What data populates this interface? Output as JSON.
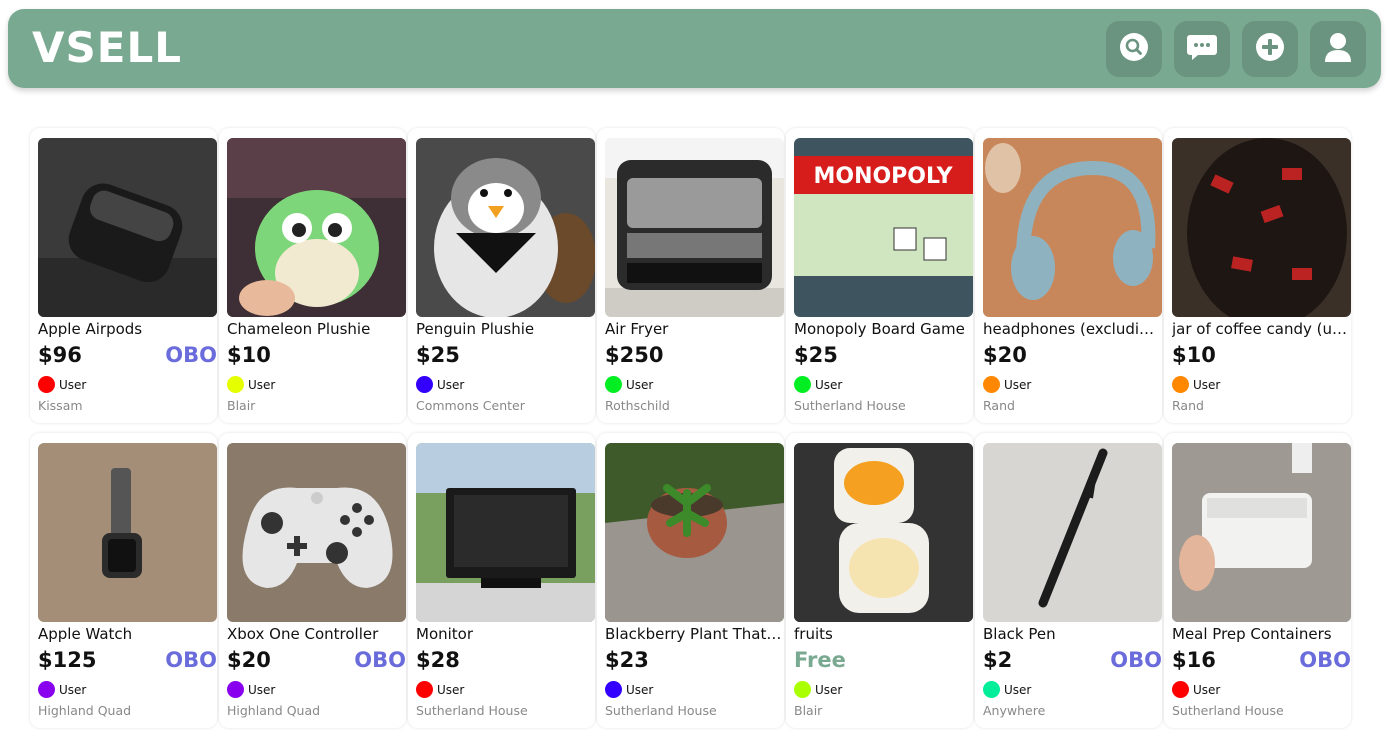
{
  "app": {
    "title": "VSELL"
  },
  "header": {
    "icons": [
      {
        "name": "search-icon"
      },
      {
        "name": "messages-icon"
      },
      {
        "name": "add-listing-icon"
      },
      {
        "name": "profile-icon"
      }
    ]
  },
  "listings": [
    {
      "title": "Apple Airpods",
      "price": "$96",
      "obo": "OBO",
      "user": "User",
      "user_color": "#ff0000",
      "location": "Kissam",
      "image": "airpods"
    },
    {
      "title": "Chameleon Plushie",
      "price": "$10",
      "obo": "",
      "user": "User",
      "user_color": "#e6ff00",
      "location": "Blair",
      "image": "plushie"
    },
    {
      "title": "Penguin Plushie",
      "price": "$25",
      "obo": "",
      "user": "User",
      "user_color": "#3300ff",
      "location": "Commons Center",
      "image": "penguin"
    },
    {
      "title": "Air Fryer",
      "price": "$250",
      "obo": "",
      "user": "User",
      "user_color": "#00ee22",
      "location": "Rothschild",
      "image": "airfryer"
    },
    {
      "title": "Monopoly Board Game",
      "price": "$25",
      "obo": "",
      "user": "User",
      "user_color": "#00ee22",
      "location": "Sutherland House",
      "image": "monopoly"
    },
    {
      "title": "headphones (excluding charger)",
      "price": "$20",
      "obo": "",
      "user": "User",
      "user_color": "#ff8800",
      "location": "Rand",
      "image": "headphones"
    },
    {
      "title": "jar of coffee candy (unopened)",
      "price": "$10",
      "obo": "",
      "user": "User",
      "user_color": "#ff8800",
      "location": "Rand",
      "image": "candy"
    },
    {
      "title": "Apple Watch",
      "price": "$125",
      "obo": "OBO",
      "user": "User",
      "user_color": "#8800ee",
      "location": "Highland Quad",
      "image": "watch"
    },
    {
      "title": "Xbox One Controller",
      "price": "$20",
      "obo": "OBO",
      "user": "User",
      "user_color": "#8800ee",
      "location": "Highland Quad",
      "image": "controller"
    },
    {
      "title": "Monitor",
      "price": "$28",
      "obo": "",
      "user": "User",
      "user_color": "#ff0000",
      "location": "Sutherland House",
      "image": "monitor"
    },
    {
      "title": "Blackberry Plant That Grows",
      "price": "$23",
      "obo": "",
      "user": "User",
      "user_color": "#3300ff",
      "location": "Sutherland House",
      "image": "plant"
    },
    {
      "title": "fruits",
      "price": "Free",
      "obo": "",
      "user": "User",
      "user_color": "#aaff00",
      "location": "Blair",
      "image": "fruits"
    },
    {
      "title": "Black Pen",
      "price": "$2",
      "obo": "OBO",
      "user": "User",
      "user_color": "#00ee99",
      "location": "Anywhere",
      "image": "pen"
    },
    {
      "title": "Meal Prep Containers",
      "price": "$16",
      "obo": "OBO",
      "user": "User",
      "user_color": "#ff0000",
      "location": "Sutherland House",
      "image": "containers"
    }
  ]
}
